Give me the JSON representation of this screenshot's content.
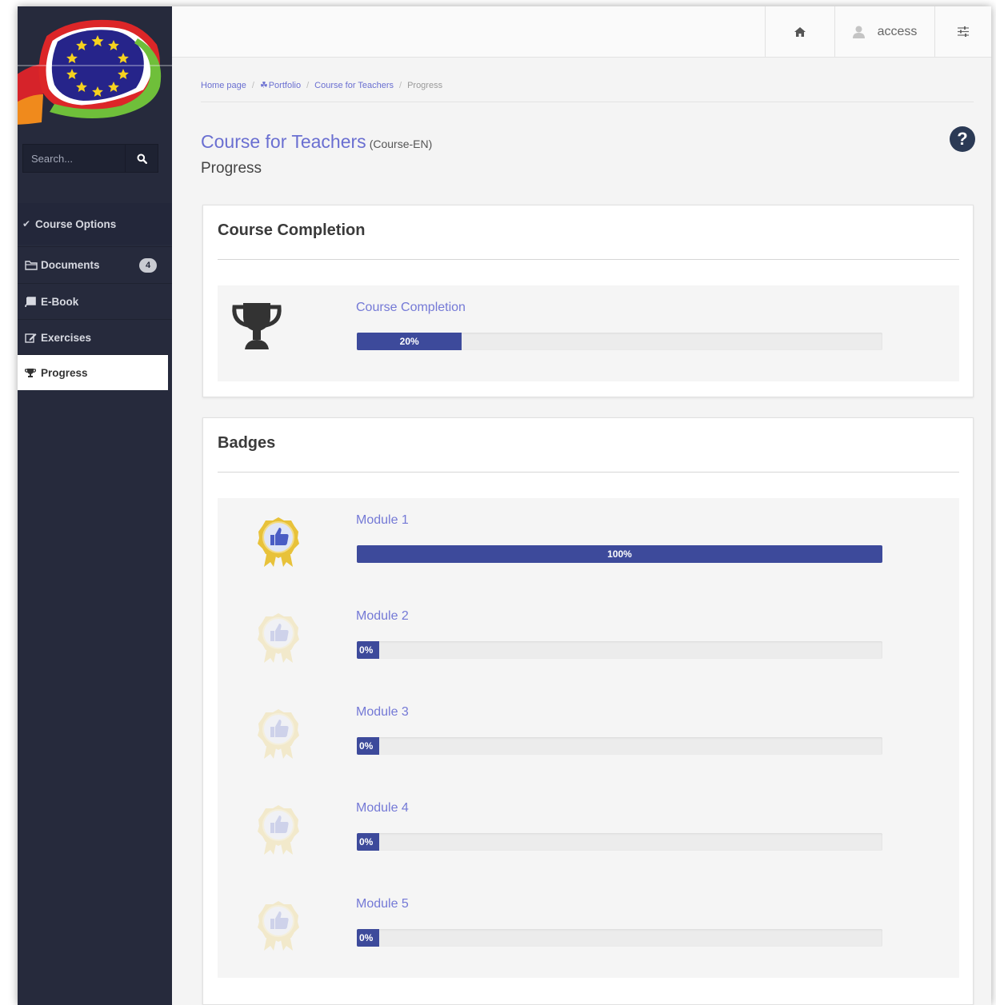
{
  "sidebar": {
    "search_placeholder": "Search...",
    "menu_header": "Course Options",
    "items": [
      {
        "label": "Documents",
        "badge": "4"
      },
      {
        "label": "E-Book"
      },
      {
        "label": "Exercises"
      },
      {
        "label": "Progress"
      }
    ]
  },
  "topbar": {
    "user_label": "access"
  },
  "breadcrumb": {
    "home": "Home page",
    "portfolio": "Portfolio",
    "course": "Course for Teachers",
    "current": "Progress"
  },
  "header": {
    "title": "Course for Teachers",
    "code": "(Course-EN)",
    "subtitle": "Progress"
  },
  "completion": {
    "panel_title": "Course Completion",
    "label": "Course Completion",
    "percent": 20,
    "percent_text": "20%"
  },
  "badges": {
    "panel_title": "Badges",
    "modules": [
      {
        "label": "Module 1",
        "percent": 100,
        "percent_text": "100%",
        "earned": true
      },
      {
        "label": "Module 2",
        "percent": 0,
        "percent_text": "0%",
        "earned": false
      },
      {
        "label": "Module 3",
        "percent": 0,
        "percent_text": "0%",
        "earned": false
      },
      {
        "label": "Module 4",
        "percent": 0,
        "percent_text": "0%",
        "earned": false
      },
      {
        "label": "Module 5",
        "percent": 0,
        "percent_text": "0%",
        "earned": false
      }
    ]
  },
  "colors": {
    "sidebar_bg": "#262a3c",
    "accent": "#6a6fd1",
    "progress_fill": "#3d4a9b",
    "badge_gold": "#e8c23a"
  }
}
